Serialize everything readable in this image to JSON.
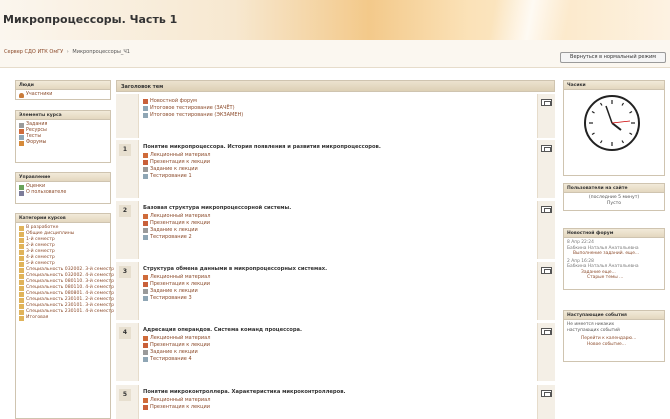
{
  "header": {
    "title": "Микропроцессоры. Часть 1",
    "breadcrumb": [
      "Сервер СДО ИТК ОмГУ",
      "Микропроцессоры_Ч1"
    ],
    "return_button": "Вернуться в нормальный режим"
  },
  "left": {
    "people": {
      "title": "Люди",
      "items": [
        {
          "label": "Участники",
          "icon": "people-icon"
        }
      ]
    },
    "activities": {
      "title": "Элементы курса",
      "items": [
        {
          "label": "Задания",
          "icon": "assignment-icon"
        },
        {
          "label": "Ресурсы",
          "icon": "resource-icon"
        },
        {
          "label": "Тесты",
          "icon": "quiz-icon"
        },
        {
          "label": "Форумы",
          "icon": "forum-icon"
        }
      ]
    },
    "admin": {
      "title": "Управление",
      "items": [
        {
          "label": "Оценки",
          "icon": "grades-icon"
        },
        {
          "label": "О пользователе",
          "icon": "user-icon"
        }
      ]
    },
    "categories": {
      "title": "Категории курсов",
      "items": [
        "В разработке",
        "Общие дисциплины",
        "1-й семестр",
        "2-й семестр",
        "3-й семестр",
        "4-й семестр",
        "5-й семестр",
        "Специальность 032002. 3-й семестр",
        "Специальность 032002. 4-й семестр",
        "Специальность 080110. 3-й семестр",
        "Специальность 080110. 4-й семестр",
        "Специальность 080801. 4-й семестр",
        "Специальность 230101. 2-й семестр",
        "Специальность 230101. 3-й семестр",
        "Специальность 230101. 4-й семестр",
        "Итоговая"
      ]
    }
  },
  "topics_header": "Заголовок тем",
  "topics": [
    {
      "num": "",
      "title": "",
      "items": [
        {
          "label": "Новостной форум",
          "icon": "news-forum-icon"
        },
        {
          "label": "Итоговое тестирование (ЗАЧЁТ)",
          "icon": "quiz-icon"
        },
        {
          "label": "Итоговое тестирование (ЭКЗАМЕН)",
          "icon": "quiz-icon"
        }
      ]
    },
    {
      "num": "1",
      "title": "Понятие микропроцессора. История появления и развития микропроцессоров.",
      "items": [
        {
          "label": "Лекционный материал",
          "icon": "document-icon"
        },
        {
          "label": "Презентация к лекции",
          "icon": "presentation-icon"
        },
        {
          "label": "Задание к лекции",
          "icon": "assignment-icon"
        },
        {
          "label": "Тестирование 1",
          "icon": "quiz-icon"
        }
      ]
    },
    {
      "num": "2",
      "title": "Базовая структура микропроцессорной системы.",
      "items": [
        {
          "label": "Лекционный материал",
          "icon": "document-icon"
        },
        {
          "label": "Презентация к лекции",
          "icon": "presentation-icon"
        },
        {
          "label": "Задание к лекции",
          "icon": "assignment-icon"
        },
        {
          "label": "Тестирование 2",
          "icon": "quiz-icon"
        }
      ]
    },
    {
      "num": "3",
      "title": "Структура обмена данными в микропроцессорных системах.",
      "items": [
        {
          "label": "Лекционный материал",
          "icon": "document-icon"
        },
        {
          "label": "Презентация к лекции",
          "icon": "presentation-icon"
        },
        {
          "label": "Задание к лекции",
          "icon": "assignment-icon"
        },
        {
          "label": "Тестирование 3",
          "icon": "quiz-icon"
        }
      ]
    },
    {
      "num": "4",
      "title": "Адресация операндов. Система команд процессора.",
      "items": [
        {
          "label": "Лекционный материал",
          "icon": "document-icon"
        },
        {
          "label": "Презентация к лекции",
          "icon": "presentation-icon"
        },
        {
          "label": "Задание к лекции",
          "icon": "assignment-icon"
        },
        {
          "label": "Тестирование 4",
          "icon": "quiz-icon"
        }
      ]
    },
    {
      "num": "5",
      "title": "Понятие микроконтроллера. Характеристика микроконтроллеров.",
      "items": [
        {
          "label": "Лекционный материал",
          "icon": "document-icon"
        },
        {
          "label": "Презентация к лекции",
          "icon": "presentation-icon"
        }
      ]
    }
  ],
  "right": {
    "clock": {
      "title": "Часики"
    },
    "online": {
      "title": "Пользователи на сайте",
      "line1": "(последние 5 минут)",
      "line2": "Пусто"
    },
    "news": {
      "title": "Новостной форум",
      "posts": [
        {
          "date": "8 Апр 22:24",
          "author": "Бабкина Наталья Анатольевна",
          "text": "Выполнение заданий. еще..."
        },
        {
          "date": "2 Апр 16:28",
          "author": "Бабкина Наталья Анатольевна",
          "text": "Задание еще...",
          "more": "Старые темы ..."
        }
      ]
    },
    "events": {
      "title": "Наступающие события",
      "text": "Не имеется никаких наступающих событий",
      "link1": "Перейти к календарю...",
      "link2": "Новое событие..."
    }
  }
}
